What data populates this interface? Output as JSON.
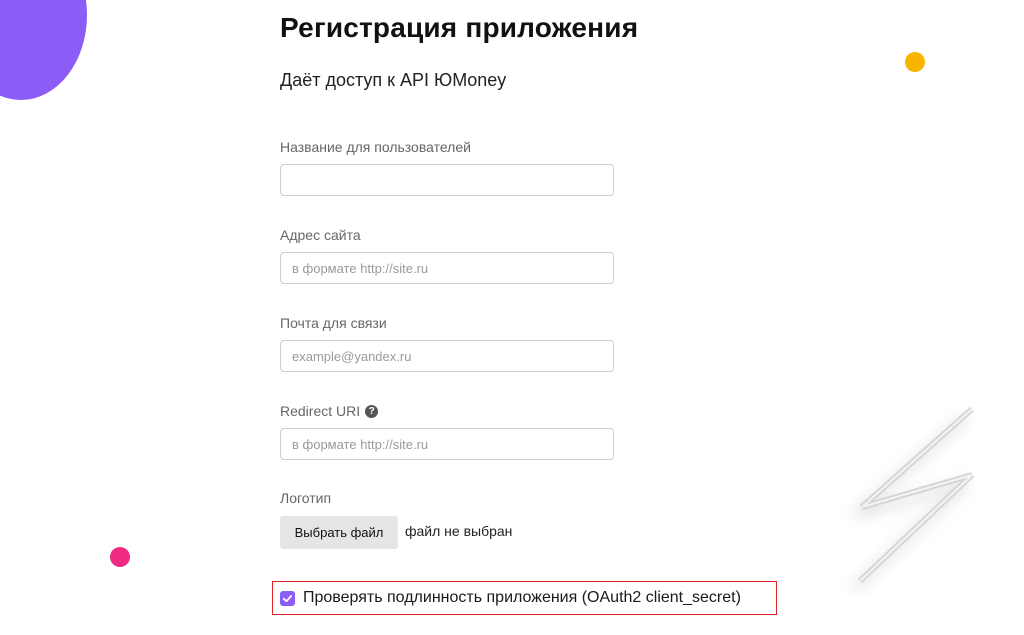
{
  "colors": {
    "accent": "#8b5cf6",
    "yellow_dot": "#f7b500",
    "pink_dot": "#ef2a82",
    "highlight_border": "#e0242a"
  },
  "page": {
    "title": "Регистрация приложения",
    "subtitle": "Даёт доступ к API ЮMoney"
  },
  "form": {
    "app_name": {
      "label": "Название для пользователей",
      "value": "",
      "placeholder": ""
    },
    "site": {
      "label": "Адрес сайта",
      "value": "",
      "placeholder": "в формате http://site.ru"
    },
    "email": {
      "label": "Почта для связи",
      "value": "",
      "placeholder": "example@yandex.ru"
    },
    "redirect": {
      "label": "Redirect URI",
      "help_icon": "question-circle-icon",
      "value": "",
      "placeholder": "в формате http://site.ru"
    },
    "logo": {
      "label": "Логотип",
      "button_label": "Выбрать файл",
      "status": "файл не выбран"
    },
    "verify": {
      "label": "Проверять подлинность приложения (OAuth2 client_secret)",
      "checked": true
    }
  },
  "icons": {
    "checkbox": "check-icon",
    "decoration": "lightning-bolt-icon"
  }
}
